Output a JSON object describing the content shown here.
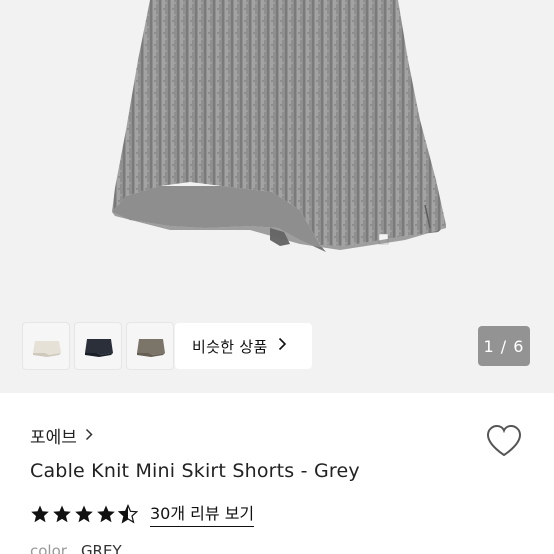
{
  "gallery": {
    "pager": "1 / 6",
    "similar_label": "비슷한 상품",
    "thumbnails": [
      "thumb-beige-shorts",
      "thumb-navy-shorts",
      "thumb-brown-shorts"
    ]
  },
  "product": {
    "brand": "포에브",
    "title": "Cable Knit Mini Skirt Shorts - Grey",
    "rating": 4.5,
    "review_link": "30개 리뷰 보기",
    "color_label": "color",
    "color_value": "GREY"
  },
  "icons": {
    "brand_chevron": "chevron-right-icon",
    "similar_chevron": "chevron-right-icon",
    "wishlist": "heart-outline-icon",
    "star": "star-icon"
  },
  "colors": {
    "knit": "#8c8c8c",
    "hero_bg": "#f2f2f2"
  }
}
